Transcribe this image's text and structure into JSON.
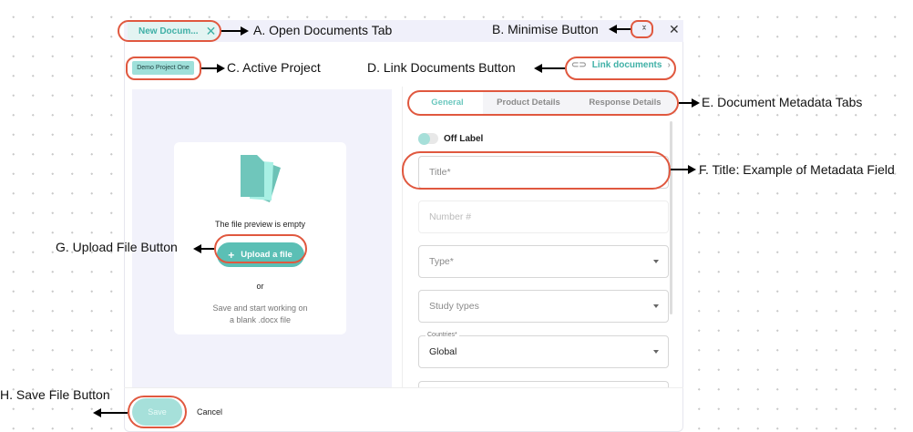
{
  "window": {
    "tab_label": "New Docum...",
    "tab_close": "✕",
    "minimise": "⌄⌃",
    "close": "✕"
  },
  "project": {
    "name": "Demo Project One"
  },
  "link_documents": {
    "label": "Link documents",
    "chevron": "›"
  },
  "tabs": [
    {
      "label": "General",
      "active": true
    },
    {
      "label": "Product Details"
    },
    {
      "label": "Response Details"
    }
  ],
  "form": {
    "toggle_label": "Off Label",
    "title_placeholder": "Title*",
    "number_placeholder": "Number #",
    "type_placeholder": "Type*",
    "study_placeholder": "Study types",
    "countries_label": "Countries*",
    "countries_value": "Global"
  },
  "preview": {
    "empty_text": "The file preview is empty",
    "upload_label": "Upload a file",
    "or": "or",
    "blank_text_1": "Save and start working on",
    "blank_text_2": "a blank .docx file"
  },
  "footer": {
    "save": "Save",
    "cancel": "Cancel"
  },
  "annotations": {
    "a": "A. Open Documents Tab",
    "b": "B. Minimise Button",
    "c": "C. Active Project",
    "d": "D. Link Documents Button",
    "e": "E. Document Metadata Tabs",
    "f": "F. Title: Example of Metadata Field",
    "g": "G. Upload File Button",
    "h": "H. Save File Button"
  },
  "colors": {
    "accent": "#5bbfb5",
    "annotation": "#e0583f"
  }
}
